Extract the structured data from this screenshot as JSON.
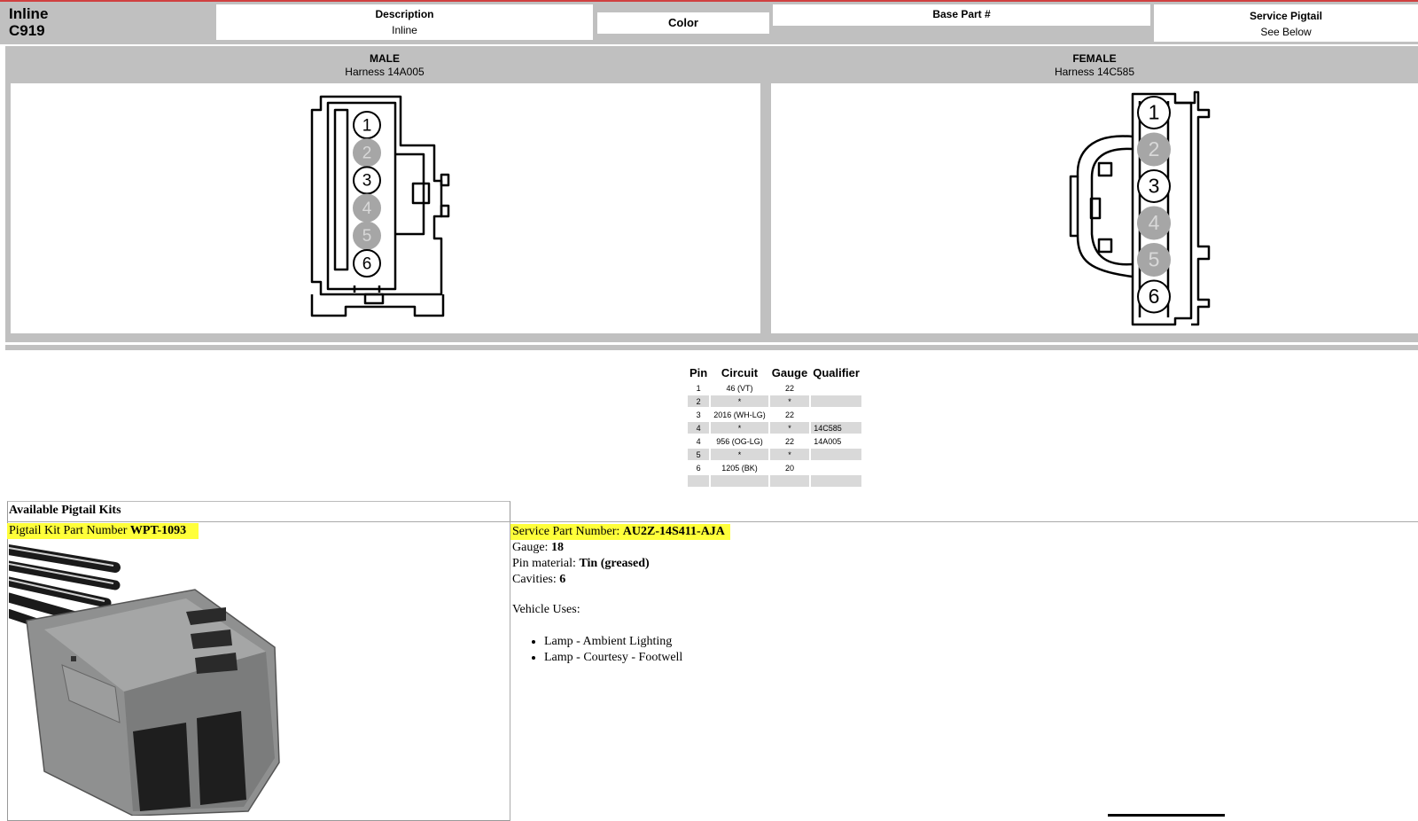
{
  "header": {
    "connector_type": "Inline",
    "connector_id": "C919",
    "description_label": "Description",
    "description_value": "Inline",
    "color_label": "Color",
    "base_part_label": "Base Part #",
    "service_pigtail_label": "Service Pigtail",
    "service_pigtail_value": "See Below"
  },
  "male": {
    "title": "MALE",
    "harness": "Harness  14A005",
    "pins": [
      "1",
      "2",
      "3",
      "4",
      "5",
      "6"
    ],
    "inactive_pins": [
      "2",
      "4",
      "5"
    ]
  },
  "female": {
    "title": "FEMALE",
    "harness": "Harness  14C585",
    "pins": [
      "1",
      "2",
      "3",
      "4",
      "5",
      "6"
    ],
    "inactive_pins": [
      "2",
      "4",
      "5"
    ]
  },
  "pin_table": {
    "headers": [
      "Pin",
      "Circuit",
      "Gauge",
      "Qualifier"
    ],
    "rows": [
      [
        "1",
        "46 (VT)",
        "22",
        ""
      ],
      [
        "2",
        "*",
        "*",
        ""
      ],
      [
        "3",
        "2016 (WH-LG)",
        "22",
        ""
      ],
      [
        "4",
        "*",
        "*",
        "14C585"
      ],
      [
        "4",
        "956 (OG-LG)",
        "22",
        "14A005"
      ],
      [
        "5",
        "*",
        "*",
        ""
      ],
      [
        "6",
        "1205 (BK)",
        "20",
        ""
      ],
      [
        "",
        "",
        "",
        ""
      ]
    ]
  },
  "pigtail": {
    "section_title": "Available Pigtail Kits",
    "kit_label": "Pigtail Kit Part Number",
    "kit_number": "WPT-1093",
    "service_part_label": "Service Part Number:",
    "service_part_number": "AU2Z-14S411-AJA",
    "gauge_label": "Gauge:",
    "gauge_value": "18",
    "pin_material_label": "Pin material:",
    "pin_material_value": "Tin (greased)",
    "cavities_label": "Cavities:",
    "cavities_value": "6",
    "vehicle_uses_label": "Vehicle Uses:",
    "vehicle_uses": [
      "Lamp - Ambient Lighting",
      "Lamp - Courtesy - Footwell"
    ]
  },
  "colors": {
    "header_gray": "#c0c0c0",
    "highlight": "#ffff3a",
    "inactive_pin": "#a6a6a6",
    "alt_row": "#d9d9d9"
  }
}
